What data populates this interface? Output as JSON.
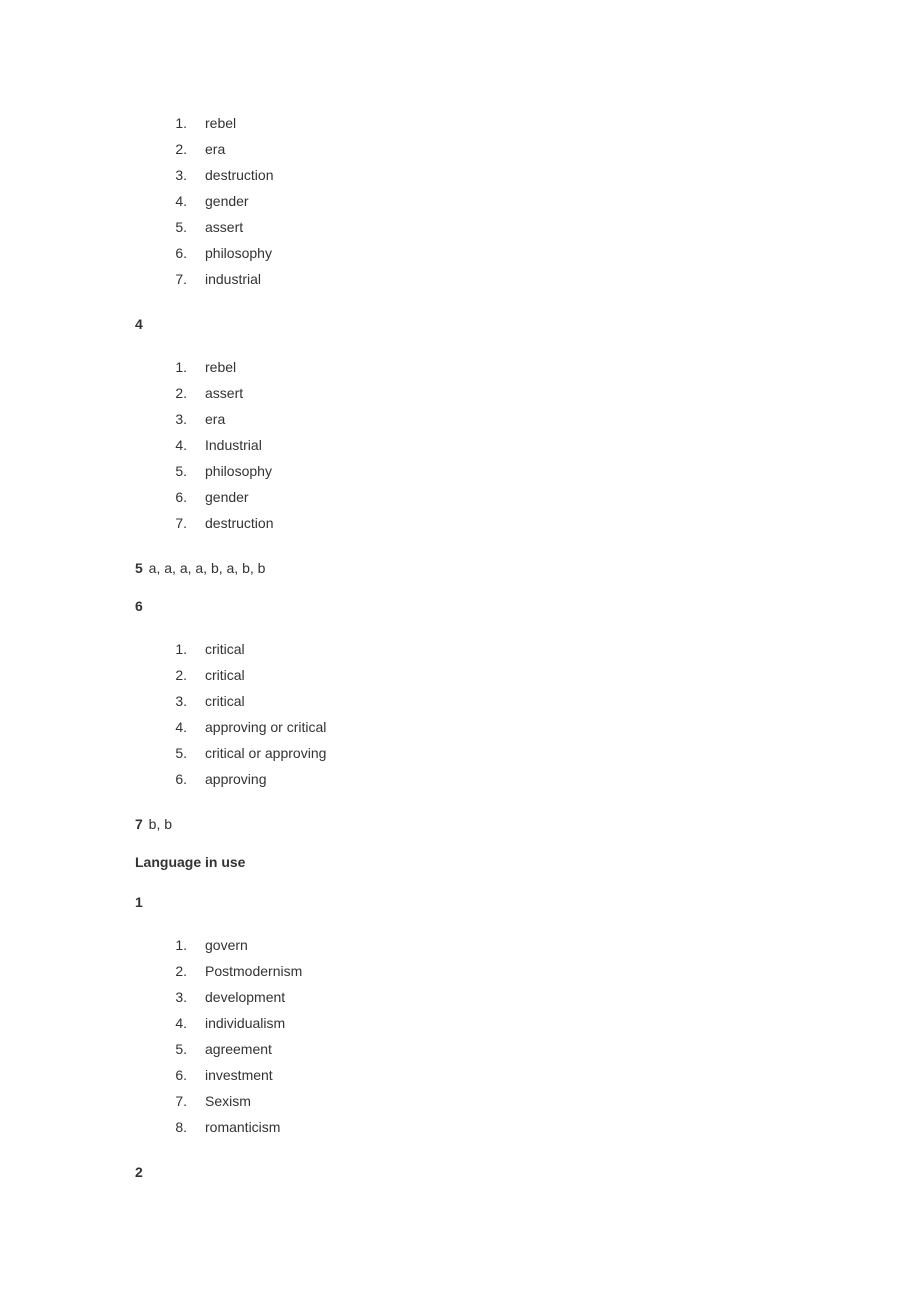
{
  "list_a": [
    "rebel",
    "era",
    "destruction",
    "gender",
    "assert",
    "philosophy",
    "industrial"
  ],
  "h4": "4",
  "list_b": [
    "rebel",
    "assert",
    "era",
    "Industrial",
    "philosophy",
    "gender",
    "destruction"
  ],
  "q5": {
    "num": "5",
    "ans": " a, a, a, a, b, a, b, b"
  },
  "h6": "6",
  "list_c": [
    "critical",
    "critical",
    "critical",
    "approving or critical",
    "critical or approving",
    "approving"
  ],
  "q7": {
    "num": "7",
    "ans": " b, b"
  },
  "section": "Language in use",
  "h1b": "1",
  "list_d": [
    "govern",
    "Postmodernism",
    "development",
    "individualism",
    "agreement",
    "investment",
    "Sexism",
    "romanticism"
  ],
  "h2b": "2"
}
